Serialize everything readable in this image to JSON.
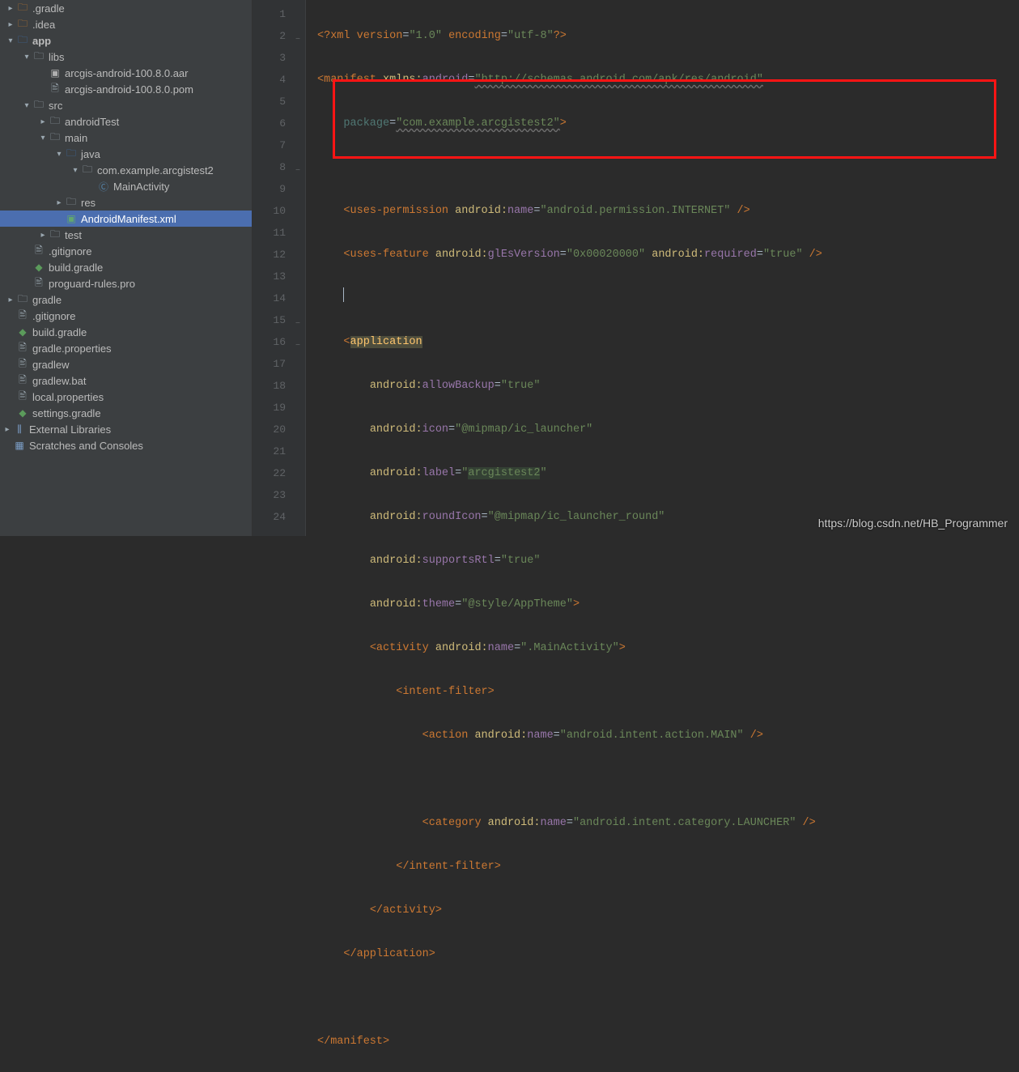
{
  "tree": {
    "gradleDir": ".gradle",
    "ideaDir": ".idea",
    "app": "app",
    "libs": "libs",
    "aar": "arcgis-android-100.8.0.aar",
    "pom": "arcgis-android-100.8.0.pom",
    "src": "src",
    "androidTest": "androidTest",
    "main": "main",
    "java": "java",
    "pkg": "com.example.arcgistest2",
    "mainActivity": "MainActivity",
    "res": "res",
    "manifest": "AndroidManifest.xml",
    "test": "test",
    "gitignore": ".gitignore",
    "buildGradle": "build.gradle",
    "proguard": "proguard-rules.pro",
    "gradleFolder": "gradle",
    "gitignore2": ".gitignore",
    "buildGradle2": "build.gradle",
    "gradleProps": "gradle.properties",
    "gradlew": "gradlew",
    "gradlewBat": "gradlew.bat",
    "localProps": "local.properties",
    "settingsGradle": "settings.gradle",
    "extLibs": "External Libraries",
    "scratches": "Scratches and Consoles"
  },
  "code": {
    "l1": {
      "p1": "<?",
      "xml": "xml version",
      "eq1": "=",
      "v1": "\"1.0\"",
      "sp1": " ",
      "enc": "encoding",
      "eq2": "=",
      "v2": "\"utf-8\"",
      "p2": "?>"
    },
    "l2": {
      "lt": "<",
      "tag": "manifest ",
      "ns": "xmlns:",
      "attr": "android",
      "eq": "=",
      "val": "\"http://schemas.android.com/apk/res/android\""
    },
    "l3": {
      "attr": "package",
      "eq": "=",
      "val": "\"com.example.arcgistest2\"",
      "gt": ">"
    },
    "l5": {
      "lt": "<",
      "tag": "uses-permission ",
      "ns": "android:",
      "attr": "name",
      "eq": "=",
      "val": "\"android.permission.INTERNET\"",
      "end": " />"
    },
    "l6": {
      "lt": "<",
      "tag": "uses-feature ",
      "ns1": "android:",
      "attr1": "glEsVersion",
      "eq1": "=",
      "val1": "\"0x00020000\"",
      "sp": " ",
      "ns2": "android:",
      "attr2": "required",
      "eq2": "=",
      "val2": "\"true\"",
      "end": " />"
    },
    "l8": {
      "lt": "<",
      "tag": "application"
    },
    "l9": {
      "ns": "android:",
      "attr": "allowBackup",
      "eq": "=",
      "val": "\"true\""
    },
    "l10": {
      "ns": "android:",
      "attr": "icon",
      "eq": "=",
      "val": "\"@mipmap/ic_launcher\""
    },
    "l11": {
      "ns": "android:",
      "attr": "label",
      "eq": "=",
      "vq": "\"",
      "val": "arcgistest2",
      "vq2": "\""
    },
    "l12": {
      "ns": "android:",
      "attr": "roundIcon",
      "eq": "=",
      "val": "\"@mipmap/ic_launcher_round\""
    },
    "l13": {
      "ns": "android:",
      "attr": "supportsRtl",
      "eq": "=",
      "val": "\"true\""
    },
    "l14": {
      "ns": "android:",
      "attr": "theme",
      "eq": "=",
      "val": "\"@style/AppTheme\"",
      "gt": ">"
    },
    "l15": {
      "lt": "<",
      "tag": "activity ",
      "ns": "android:",
      "attr": "name",
      "eq": "=",
      "val": "\".MainActivity\"",
      "gt": ">"
    },
    "l16": {
      "lt": "<",
      "tag": "intent-filter",
      "gt": ">"
    },
    "l17": {
      "lt": "<",
      "tag": "action ",
      "ns": "android:",
      "attr": "name",
      "eq": "=",
      "val": "\"android.intent.action.MAIN\"",
      "end": " />"
    },
    "l19": {
      "lt": "<",
      "tag": "category ",
      "ns": "android:",
      "attr": "name",
      "eq": "=",
      "val": "\"android.intent.category.LAUNCHER\"",
      "end": " />"
    },
    "l20": {
      "t": "</intent-filter>"
    },
    "l21": {
      "t": "</activity>"
    },
    "l22": {
      "t": "</application>"
    },
    "l24": {
      "t": "</manifest>"
    }
  },
  "watermark": "https://blog.csdn.net/HB_Programmer"
}
